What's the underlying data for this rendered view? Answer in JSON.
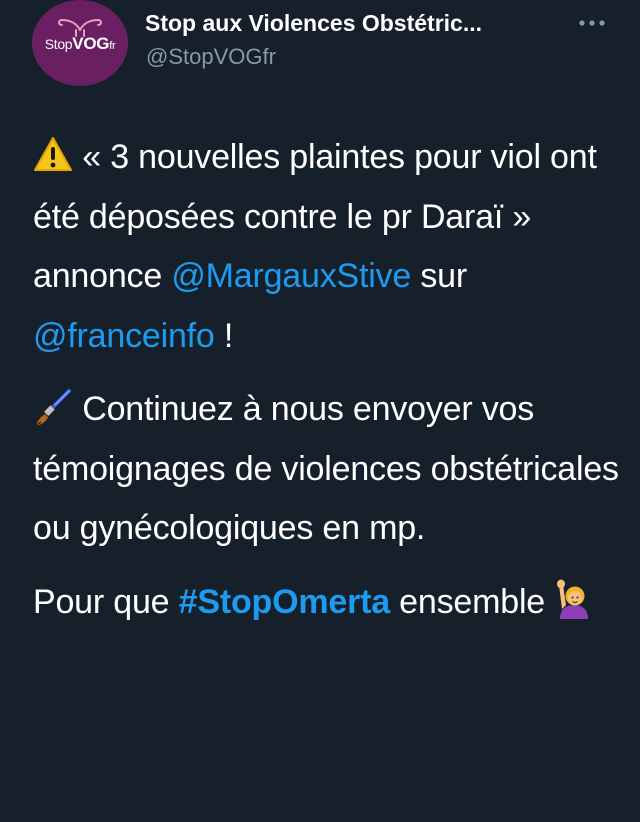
{
  "author": {
    "display_name": "Stop aux Violences Obstétric...",
    "handle": "@StopVOGfr",
    "avatar_logo": {
      "stop": "Stop",
      "vog": "VOG",
      "fr": "fr"
    }
  },
  "menu": {
    "icon": "more-horizontal-icon"
  },
  "tweet": {
    "p1": {
      "emoji": "warning-icon",
      "text_a": " « 3 nouvelles plaintes pour viol ont été déposées contre le pr Daraï » annonce ",
      "mention1": "@MargauxStive",
      "text_b": " sur ",
      "mention2": "@franceinfo",
      "text_c": " !"
    },
    "p2": {
      "emoji": "paintbrush-icon",
      "text": " Continuez à nous envoyer vos témoignages de violences obstétricales ou gynécologiques en mp."
    },
    "p3": {
      "text_a": "Pour que ",
      "hashtag": "#StopOmerta",
      "text_b": " ensemble ",
      "emoji": "raising-hand-icon"
    }
  },
  "colors": {
    "background": "#15202b",
    "link": "#1d9bf0",
    "secondary_text": "#8899a6",
    "avatar_bg": "#6b1f63"
  }
}
